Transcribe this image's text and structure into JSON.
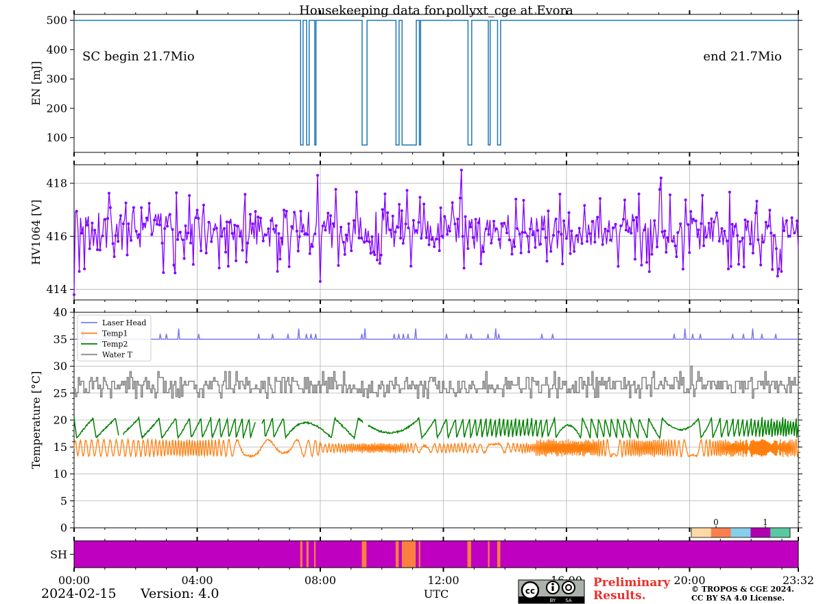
{
  "title": "Housekeeping data for pollyxt_cge at Evora",
  "date": "2024-02-15",
  "version": "Version: 4.0",
  "x_axis": {
    "label": "UTC",
    "range_hours": [
      0,
      23.533
    ],
    "ticks": [
      {
        "h": 0,
        "label": "00:00"
      },
      {
        "h": 4,
        "label": "04:00"
      },
      {
        "h": 8,
        "label": "08:00"
      },
      {
        "h": 12,
        "label": "12:00"
      },
      {
        "h": 16,
        "label": "16:00"
      },
      {
        "h": 20,
        "label": "20:00"
      },
      {
        "h": 23.533,
        "label": "23:32"
      }
    ]
  },
  "footer": {
    "preliminary_line1": "Preliminary",
    "preliminary_line2": "Results.",
    "copyright_line1": "© TROPOS & CGE 2024.",
    "copyright_line2": "CC BY SA 4.0 License.",
    "cc_by": "BY",
    "cc_sa": "SA",
    "cc_text": "cc",
    "preliminary_color": "#e8302a"
  },
  "chart_data": [
    {
      "type": "line",
      "panel": "energy",
      "ylabel": "EN [mJ]",
      "ylim": [
        50,
        520
      ],
      "yticks": [
        100,
        200,
        300,
        400,
        500
      ],
      "grid": false,
      "color": "#1f77b4",
      "annotation_left": "SC begin 21.7Mio",
      "annotation_right": "end 21.7Mio",
      "baseline": 500,
      "low_value": 75,
      "drop_intervals_hours": [
        [
          7.35,
          7.42
        ],
        [
          7.55,
          7.62
        ],
        [
          7.8,
          7.85
        ],
        [
          9.35,
          9.5
        ],
        [
          10.45,
          10.55
        ],
        [
          10.65,
          11.1
        ],
        [
          11.2,
          11.25
        ],
        [
          12.78,
          12.9
        ],
        [
          13.45,
          13.5
        ],
        [
          13.75,
          13.85
        ]
      ]
    },
    {
      "type": "line",
      "panel": "hv1064",
      "ylabel": "HV1064 [V]",
      "ylim": [
        413.6,
        418.7
      ],
      "yticks": [
        414,
        416,
        418
      ],
      "grid": true,
      "color": "#7f00ff",
      "mean": 416.2,
      "typical_range": [
        415.2,
        417.3
      ],
      "start_value": 413.8,
      "max_value": 418.5,
      "min_value": 414.3
    },
    {
      "type": "line",
      "panel": "temperature",
      "ylabel": "Temperature [$^\\circ C$]",
      "ylim": [
        0,
        40
      ],
      "yticks": [
        0,
        5,
        10,
        15,
        20,
        25,
        30,
        35,
        40
      ],
      "grid": true,
      "legend_position": "top-left",
      "series": [
        {
          "name": "Laser Head",
          "color": "#7b7bf0",
          "base": 35,
          "spike_peak": 37
        },
        {
          "name": "Temp1",
          "color": "#ff7f0e",
          "range": [
            13,
            16.5
          ]
        },
        {
          "name": "Temp2",
          "color": "#008000",
          "range": [
            16,
            20.5
          ]
        },
        {
          "name": "Water T",
          "color": "#808080",
          "range": [
            24,
            29
          ]
        }
      ]
    },
    {
      "type": "heatmap",
      "panel": "shutter",
      "ylabel": "SH",
      "colorbar_ticks": [
        {
          "value": 0,
          "label": "0"
        },
        {
          "value": 1,
          "label": "1"
        }
      ],
      "colors": [
        "#fdd9a6",
        "#fb7f4e",
        "#87ceeb",
        "#b000b0",
        "#5ac8a0"
      ],
      "background_color": "#c000c0",
      "open_color": "#fa8040",
      "open_intervals_hours": [
        [
          7.35,
          7.42
        ],
        [
          7.55,
          7.62
        ],
        [
          7.8,
          7.85
        ],
        [
          9.35,
          9.5
        ],
        [
          10.45,
          10.55
        ],
        [
          10.65,
          11.1
        ],
        [
          11.2,
          11.25
        ],
        [
          12.78,
          12.9
        ],
        [
          13.45,
          13.5
        ],
        [
          13.75,
          13.85
        ]
      ]
    }
  ]
}
